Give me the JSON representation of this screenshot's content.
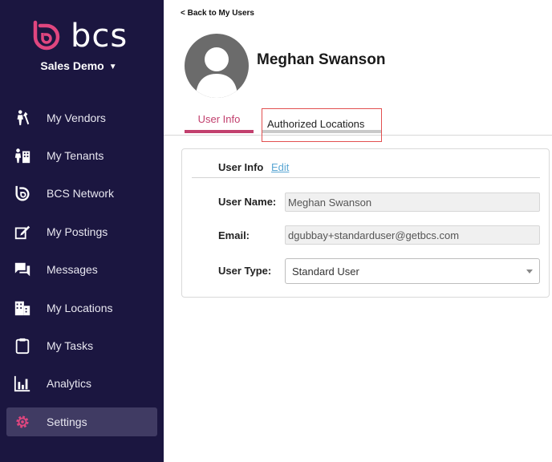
{
  "brand": {
    "name": "bcs",
    "accent": "#e0467f",
    "sidebar_bg": "#1b1640"
  },
  "org": {
    "name": "Sales Demo",
    "caret": "▼"
  },
  "sidebar": {
    "items": [
      {
        "label": "My Vendors",
        "icon": "vendors-icon"
      },
      {
        "label": "My Tenants",
        "icon": "tenants-icon"
      },
      {
        "label": "BCS Network",
        "icon": "bcs-network-icon"
      },
      {
        "label": "My Postings",
        "icon": "postings-icon"
      },
      {
        "label": "Messages",
        "icon": "messages-icon"
      },
      {
        "label": "My Locations",
        "icon": "locations-icon"
      },
      {
        "label": "My Tasks",
        "icon": "tasks-icon"
      },
      {
        "label": "Analytics",
        "icon": "analytics-icon"
      },
      {
        "label": "Settings",
        "icon": "gear-icon",
        "active": true
      }
    ]
  },
  "header": {
    "back_label": "< Back to My Users",
    "user_name": "Meghan Swanson"
  },
  "tabs": [
    {
      "label": "User Info",
      "active": true
    },
    {
      "label": "Authorized Locations",
      "highlighted": true
    }
  ],
  "card": {
    "title": "User Info",
    "edit_label": "Edit",
    "fields": {
      "user_name_label": "User Name:",
      "user_name_value": "Meghan Swanson",
      "email_label": "Email:",
      "email_value": "dgubbay+standarduser@getbcs.com",
      "user_type_label": "User Type:",
      "user_type_value": "Standard User"
    }
  }
}
